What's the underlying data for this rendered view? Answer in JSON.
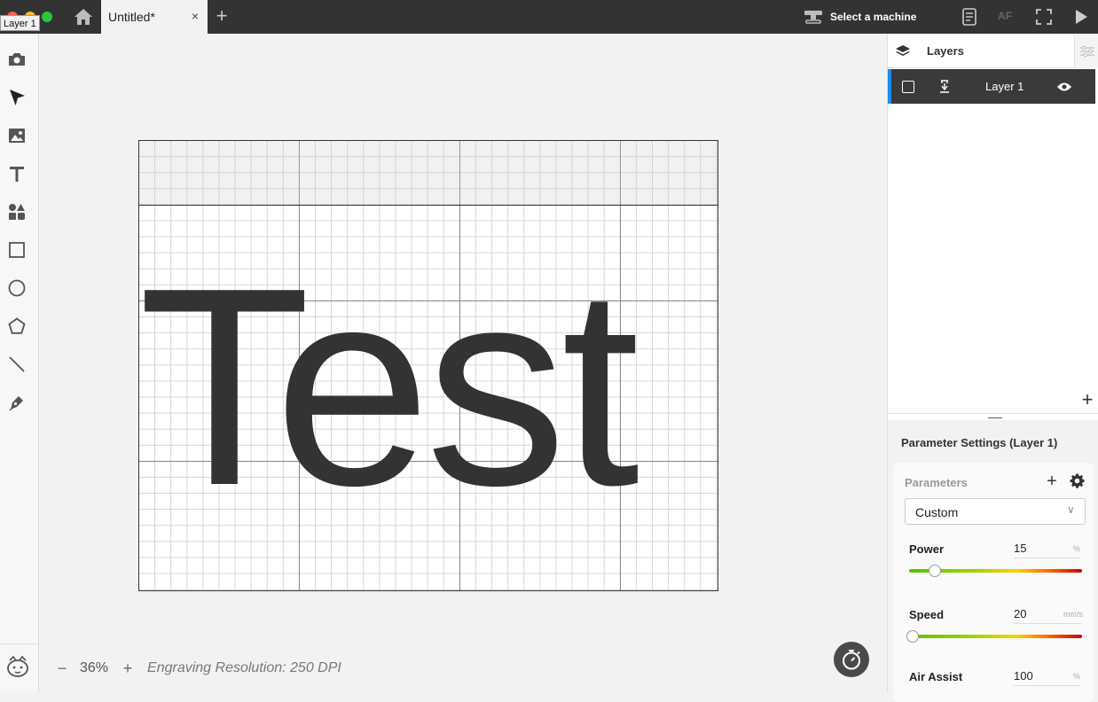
{
  "titlebar": {
    "tooltip": "Layer 1",
    "tab_title": "Untitled*",
    "tab_close": "×",
    "new_tab": "+",
    "machine_label": "Select a machine",
    "af_label": "AF"
  },
  "toolbar": {
    "tools": [
      "camera-icon",
      "select-arrow-icon",
      "image-icon",
      "text-icon",
      "elements-icon",
      "rectangle-icon",
      "ellipse-icon",
      "polygon-icon",
      "line-icon",
      "pen-icon"
    ]
  },
  "canvas": {
    "text_object": "Test",
    "zoom_minus": "−",
    "zoom_value": "36%",
    "zoom_plus": "+",
    "resolution": "Engraving Resolution: 250 DPI"
  },
  "layers": {
    "title": "Layers",
    "items": [
      {
        "name": "Layer 1",
        "selected": true,
        "visible": true,
        "accent_color": "#1c8cf0"
      }
    ],
    "add_label": "+"
  },
  "parameters": {
    "title": "Parameter Settings (Layer 1)",
    "section_label": "Parameters",
    "add_label": "+",
    "preset_value": "Custom",
    "preset_caret": "∨",
    "power": {
      "label": "Power",
      "value": "15",
      "unit": "%",
      "fraction": 0.15
    },
    "speed": {
      "label": "Speed",
      "value": "20",
      "unit": "mm/s",
      "fraction": 0.02
    },
    "air_assist": {
      "label": "Air Assist",
      "value": "100",
      "unit": "%"
    }
  }
}
